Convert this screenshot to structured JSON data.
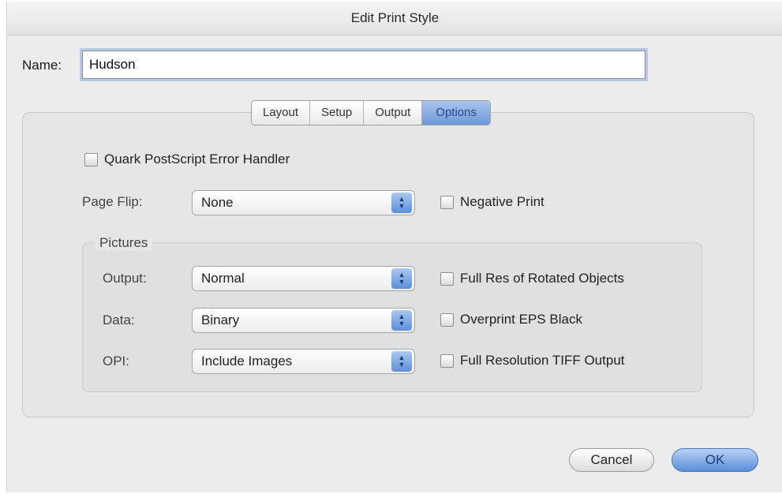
{
  "window": {
    "title": "Edit Print Style"
  },
  "name": {
    "label": "Name:",
    "value": "Hudson"
  },
  "tabs": [
    {
      "label": "Layout"
    },
    {
      "label": "Setup"
    },
    {
      "label": "Output"
    },
    {
      "label": "Options",
      "active": true
    }
  ],
  "options": {
    "error_handler": {
      "label": "Quark PostScript Error Handler",
      "checked": false
    },
    "page_flip": {
      "label": "Page Flip:",
      "value": "None"
    },
    "negative_print": {
      "label": "Negative Print",
      "checked": false
    }
  },
  "pictures": {
    "title": "Pictures",
    "output": {
      "label": "Output:",
      "value": "Normal"
    },
    "data": {
      "label": "Data:",
      "value": "Binary"
    },
    "opi": {
      "label": "OPI:",
      "value": "Include Images"
    },
    "full_res_rotated": {
      "label": "Full Res of Rotated Objects",
      "checked": false
    },
    "overprint_eps": {
      "label": "Overprint EPS Black",
      "checked": false
    },
    "full_res_tiff": {
      "label": "Full Resolution TIFF Output",
      "checked": false
    }
  },
  "buttons": {
    "cancel": "Cancel",
    "ok": "OK"
  },
  "colors": {
    "accent": "#6f98d9",
    "background": "#ececec"
  }
}
